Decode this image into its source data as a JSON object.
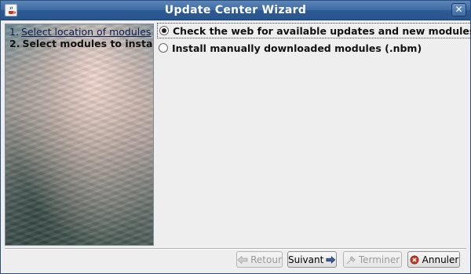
{
  "window": {
    "title": "Update Center Wizard"
  },
  "steps": [
    {
      "number": "1.",
      "label": "Select location of modules"
    },
    {
      "number": "2.",
      "label": "Select modules to install"
    }
  ],
  "options": [
    {
      "label": "Check the web for available updates and new modules",
      "selected": true
    },
    {
      "label": "Install manually downloaded modules (.nbm)",
      "selected": false
    }
  ],
  "buttons": {
    "back": "Retour",
    "next": "Suivant",
    "finish": "Terminer",
    "cancel": "Annuler"
  },
  "icons": {
    "app": "java-cup-icon",
    "close": "close-icon",
    "back": "arrow-left-icon",
    "next": "arrow-right-icon",
    "finish": "finish-icon",
    "cancel": "cancel-icon"
  }
}
